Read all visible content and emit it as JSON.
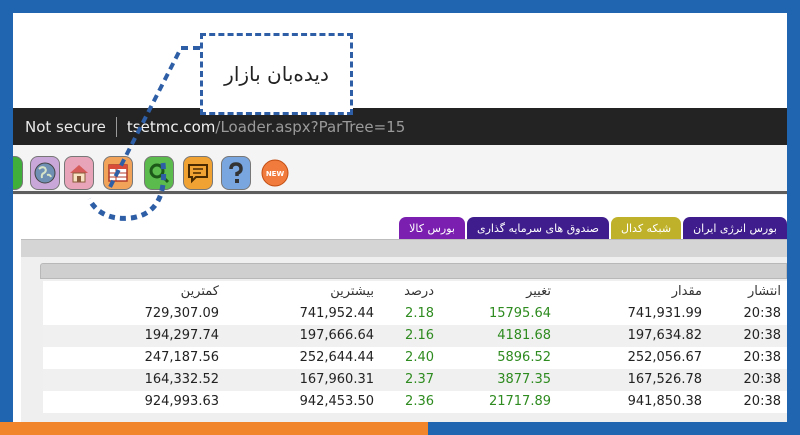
{
  "callout": {
    "label": "دیده‌بان بازار"
  },
  "address_bar": {
    "security": "Not secure",
    "host": "tsetmc.com",
    "path": "/Loader.aspx?ParTree=15"
  },
  "toolbar": {
    "buttons": [
      {
        "name": "globe",
        "icon": "globe-icon",
        "color": "#c9a8d9"
      },
      {
        "name": "home",
        "icon": "home-icon",
        "color": "#e8a4b8"
      },
      {
        "name": "market-watch",
        "icon": "table-icon",
        "color": "#f2a35a"
      },
      {
        "name": "search",
        "icon": "search-icon",
        "color": "#5bbb4d"
      },
      {
        "name": "messages",
        "icon": "message-icon",
        "color": "#f0a233"
      },
      {
        "name": "help",
        "icon": "help-icon",
        "color": "#7aa6e0"
      },
      {
        "name": "new",
        "icon": "new-badge-icon",
        "color": "#f07b3c",
        "label": "NEW"
      }
    ]
  },
  "market_tabs": [
    {
      "label": "بورس انرژی ایران",
      "color": "#3f1d8c"
    },
    {
      "label": "شبکه کدال",
      "color": "#bfb22a"
    },
    {
      "label": "صندوق های سرمایه گذاری",
      "color": "#3f1d8c"
    },
    {
      "label": "بورس کالا",
      "color": "#7a1fb0"
    }
  ],
  "table": {
    "headers": {
      "time": "انتشار",
      "volume": "مقدار",
      "change": "تغییر",
      "percent": "درصد",
      "max": "بیشترین",
      "min": "کمترین"
    },
    "rows": [
      {
        "time": "20:38",
        "volume": "741,931.99",
        "change": "15795.64",
        "percent": "2.18",
        "max": "741,952.44",
        "min": "729,307.09"
      },
      {
        "time": "20:38",
        "volume": "197,634.82",
        "change": "4181.68",
        "percent": "2.16",
        "max": "197,666.64",
        "min": "194,297.74"
      },
      {
        "time": "20:38",
        "volume": "252,056.67",
        "change": "5896.52",
        "percent": "2.40",
        "max": "252,644.44",
        "min": "247,187.56"
      },
      {
        "time": "20:38",
        "volume": "167,526.78",
        "change": "3877.35",
        "percent": "2.37",
        "max": "167,960.31",
        "min": "164,332.52"
      },
      {
        "time": "20:38",
        "volume": "941,850.38",
        "change": "21717.89",
        "percent": "2.36",
        "max": "942,453.50",
        "min": "924,993.63"
      }
    ]
  },
  "colors": {
    "frame": "#1f65b0",
    "accent_bar": "#f1852b",
    "positive": "#2e8b1f",
    "highlight": "#2e5fa6"
  }
}
